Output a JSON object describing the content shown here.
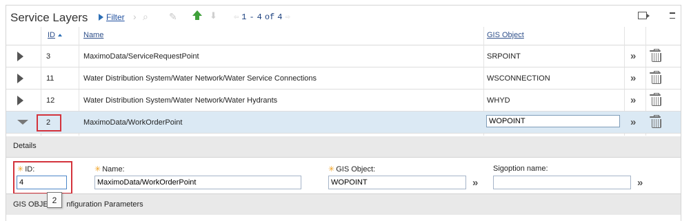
{
  "header": {
    "title": "Service Layers",
    "filter_label": "Filter",
    "pager": {
      "start": "1",
      "sep": "-",
      "end": "4",
      "of": "of",
      "total": "4"
    }
  },
  "columns": {
    "id": "ID",
    "name": "Name",
    "gis_object": "GIS Object"
  },
  "rows": [
    {
      "id": "3",
      "name": "MaximoData/ServiceRequestPoint",
      "gis_object": "SRPOINT"
    },
    {
      "id": "11",
      "name": "Water Distribution System/Water Network/Water Service Connections",
      "gis_object": "WSCONNECTION"
    },
    {
      "id": "12",
      "name": "Water Distribution System/Water Network/Water Hydrants",
      "gis_object": "WHYD"
    },
    {
      "id": "2",
      "name": "MaximoData/WorkOrderPoint",
      "gis_object": "WOPOINT"
    }
  ],
  "details": {
    "section_label": "Details",
    "id_label": "ID:",
    "id_value": "4",
    "name_label": "Name:",
    "name_value": "MaximoData/WorkOrderPoint",
    "gis_object_label": "GIS Object:",
    "gis_object_value": "WOPOINT",
    "sigoption_label": "Sigoption name:",
    "sigoption_value": ""
  },
  "gis_config": {
    "label_left": "GIS OBJECT",
    "label_right": "nfiguration Parameters"
  },
  "tooltip": {
    "text": "2"
  },
  "colors": {
    "accent": "#2d6fb6",
    "selected_row": "#dbe9f4",
    "highlight": "#d3323b",
    "section_bg": "#e9e9e9"
  },
  "icons": [
    "filter-icon",
    "next-icon",
    "search-icon",
    "clear-icon",
    "move-up-icon",
    "move-down-icon",
    "prev-page-icon",
    "next-page-icon",
    "export-icon",
    "collapse-icon",
    "expand-row-icon",
    "collapse-row-icon",
    "select-value-icon",
    "delete-icon"
  ]
}
